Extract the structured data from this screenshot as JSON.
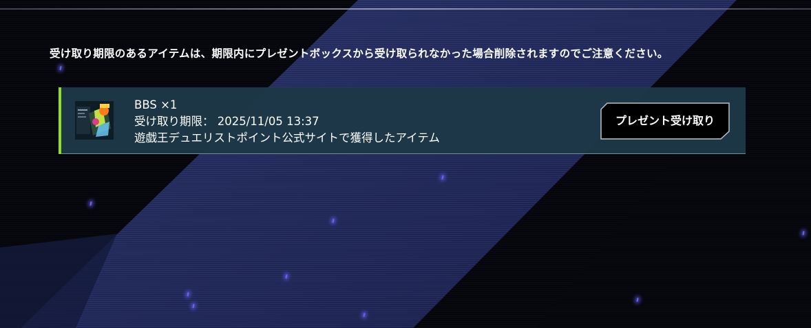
{
  "notice": "受け取り期限のあるアイテムは、期限内にプレゼントボックスから受け取られなかった場合削除されますのでご注意ください。",
  "present": {
    "item_name": "BBS ×1",
    "deadline_label": "受け取り期限：",
    "deadline_value": "2025/11/05 13:37",
    "source": "遊戯王デュエリストポイント公式サイトで獲得したアイテム",
    "receive_button_label": "プレゼント受け取り",
    "thumbnail_icon": "item-thumbnail-icon"
  },
  "colors": {
    "accent": "#8fe01f",
    "card_background": "#1d3848",
    "button_background": "#000000",
    "sparkle": "#6a64ff"
  }
}
